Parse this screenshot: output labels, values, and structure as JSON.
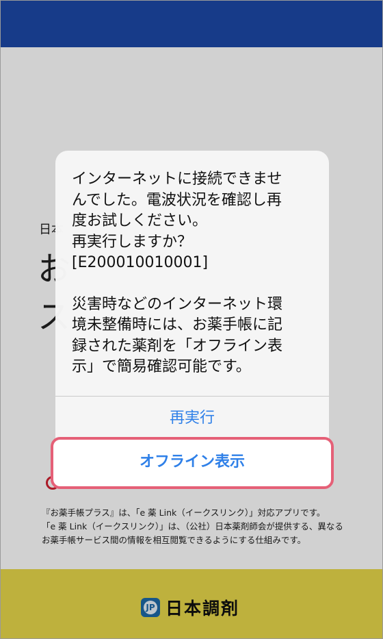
{
  "background": {
    "subtitle": "日本",
    "title": "お　　　　　　　　　ス",
    "notes": [
      "『お薬手帳プラス』は、「e 薬 Link（イークスリンク）」対応アプリです。",
      "「e 薬 Link（イークスリンク）」は、（公社）日本薬剤師会が提供する、異なる",
      "お薬手帳サービス間の情報を相互閲覧できるようにする仕組みです。"
    ],
    "footer_icon_text": "JP",
    "footer_brand": "日本調剤"
  },
  "dialog": {
    "message_lines": [
      "インターネットに接続できませ",
      "んでした。電波状況を確認し再",
      "度お試しください。",
      "再実行しますか？",
      "[E200010010001]"
    ],
    "info_lines": [
      "災害時などのインターネット環",
      "境未整備時には、お薬手帳に記",
      "録された薬剤を「オフライン表",
      "示」で簡易確認可能です。"
    ],
    "retry_label": "再実行",
    "offline_label": "オフライン表示"
  },
  "colors": {
    "header": "#1d49a8",
    "footer": "#e8d84b",
    "accent": "#2f80e8",
    "highlight": "#e56077"
  }
}
